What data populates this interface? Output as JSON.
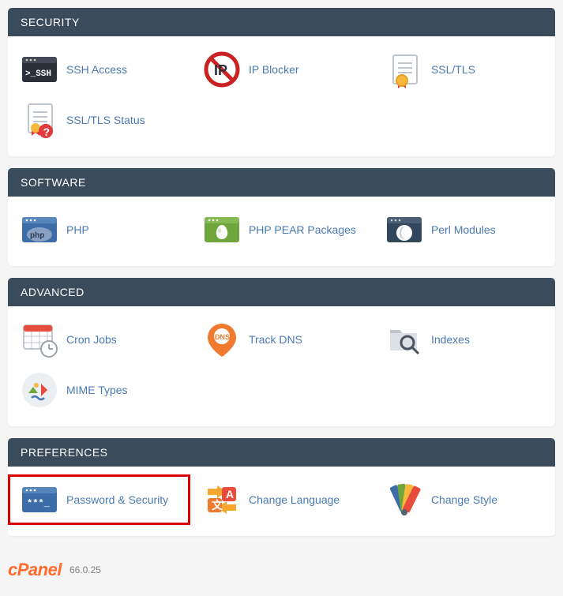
{
  "sections": [
    {
      "title": "SECURITY",
      "rows": [
        {
          "key": "ssh-access",
          "label": "SSH Access",
          "icon": "ssh-icon"
        },
        {
          "key": "ip-blocker",
          "label": "IP Blocker",
          "icon": "ip-blocker-icon"
        },
        {
          "key": "ssl-tls",
          "label": "SSL/TLS",
          "icon": "ssl-tls-icon"
        },
        {
          "key": "ssl-status",
          "label": "SSL/TLS Status",
          "icon": "ssl-status-icon"
        }
      ]
    },
    {
      "title": "SOFTWARE",
      "rows": [
        {
          "key": "php",
          "label": "PHP",
          "icon": "php-icon"
        },
        {
          "key": "php-pear",
          "label": "PHP PEAR Packages",
          "icon": "pear-icon"
        },
        {
          "key": "perl-modules",
          "label": "Perl Modules",
          "icon": "perl-icon"
        }
      ]
    },
    {
      "title": "ADVANCED",
      "rows": [
        {
          "key": "cron-jobs",
          "label": "Cron Jobs",
          "icon": "cron-icon"
        },
        {
          "key": "track-dns",
          "label": "Track DNS",
          "icon": "dns-icon"
        },
        {
          "key": "indexes",
          "label": "Indexes",
          "icon": "indexes-icon"
        },
        {
          "key": "mime-types",
          "label": "MIME Types",
          "icon": "mime-icon"
        }
      ]
    },
    {
      "title": "PREFERENCES",
      "rows": [
        {
          "key": "password-security",
          "label": "Password & Security",
          "icon": "password-icon",
          "highlight": true
        },
        {
          "key": "change-language",
          "label": "Change Language",
          "icon": "language-icon"
        },
        {
          "key": "change-style",
          "label": "Change Style",
          "icon": "style-icon"
        }
      ]
    }
  ],
  "footer": {
    "brand": "cPanel",
    "version": "66.0.25"
  }
}
